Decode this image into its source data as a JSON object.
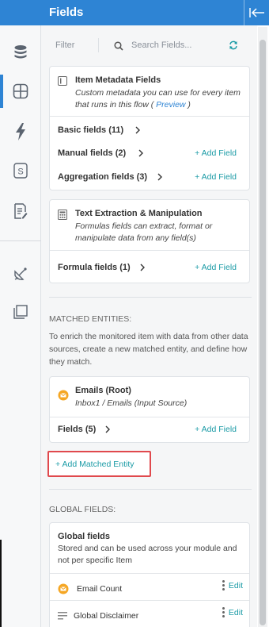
{
  "header": {
    "title": "Fields"
  },
  "rail": {
    "items": [
      {
        "icon": "database-icon"
      },
      {
        "icon": "fields-grid-icon",
        "active": true
      },
      {
        "icon": "lightning-icon"
      },
      {
        "icon": "s-box-icon",
        "glyph": "S"
      },
      {
        "icon": "document-edit-icon"
      },
      {
        "icon": "satellite-icon"
      },
      {
        "icon": "layers-icon"
      }
    ]
  },
  "filterbar": {
    "filter_label": "Filter",
    "search_placeholder": "Search Fields..."
  },
  "metadata_card": {
    "title": "Item Metadata Fields",
    "desc_text": "Custom metadata you can use for every item that runs in this flow (",
    "preview": "Preview",
    "desc_end": ")",
    "rows": [
      {
        "label": "Basic fields (11)",
        "add": ""
      },
      {
        "label": "Manual fields (2)",
        "add": "+ Add Field"
      },
      {
        "label": "Aggregation fields (3)",
        "add": "+ Add Field"
      }
    ]
  },
  "text_card": {
    "title": "Text Extraction & Manipulation",
    "desc": "Formulas fields can extract, format or manipulate data from any field(s)",
    "row": {
      "label": "Formula fields (1)",
      "add": "+ Add Field"
    }
  },
  "matched": {
    "title": "MATCHED ENTITIES:",
    "desc": "To enrich the monitored item with data from other data sources, create a new matched entity, and define how they match.",
    "entity": {
      "title": "Emails (Root)",
      "subtitle": "Inbox1 / Emails (Input Source)",
      "row": {
        "label": "Fields (5)",
        "add": "+ Add Field"
      }
    },
    "add_button": "+ Add Matched Entity"
  },
  "global": {
    "title": "GLOBAL FIELDS:",
    "card_title": "Global fields",
    "card_desc": "Stored and can be used across your module and not per specific Item",
    "rows": [
      {
        "label": "Email Count",
        "edit": "Edit",
        "icon": "email-count-icon"
      },
      {
        "label": "Global Disclaimer",
        "edit": "Edit",
        "icon": "text-lines-icon"
      }
    ]
  },
  "colors": {
    "brand": "#2e84d4",
    "accent": "#1b9ba6",
    "highlight": "#e0494d",
    "badge": "#f5a623"
  }
}
